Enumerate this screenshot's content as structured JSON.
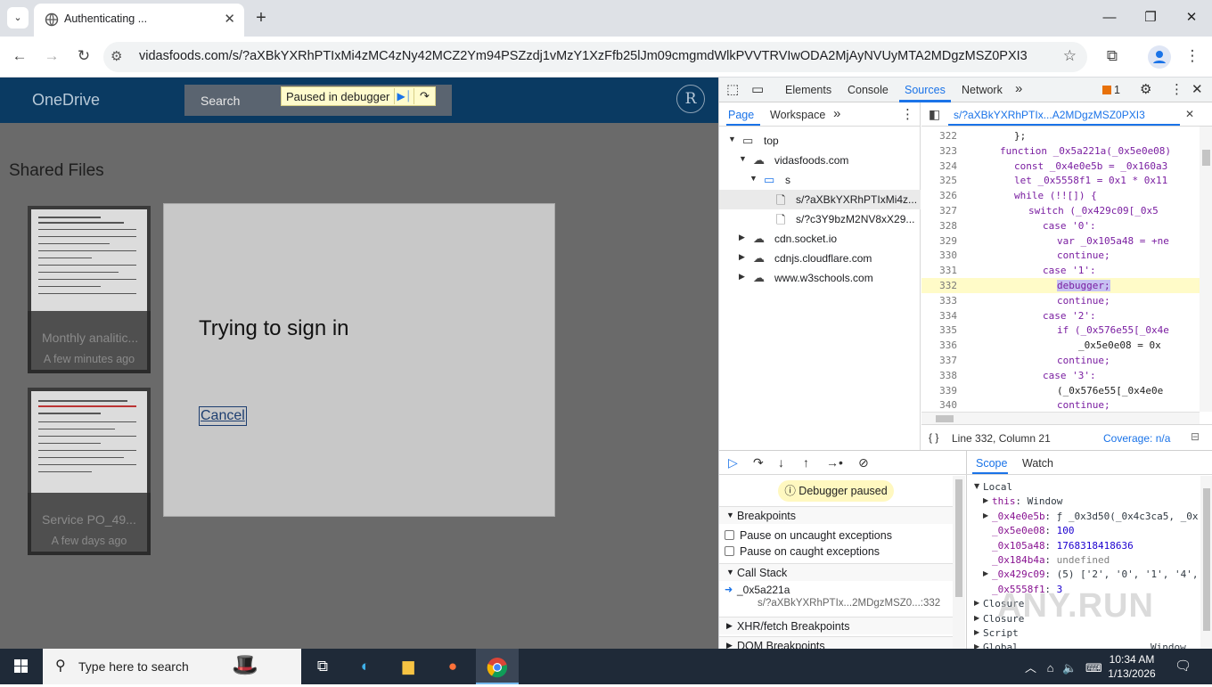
{
  "browser": {
    "tab_title": "Authenticating ...",
    "url": "vidasfoods.com/s/?aXBkYXRhPTIxMi4zMC4zNy42MCZ2Ym94PSZzdj1vMzY1XzFfb25lJm09cmgmdWlkPVVTRVIwODA2MjAyNVUyMTA2MDgzMSZ0PXI3",
    "minimize_glyph": "—",
    "maximize_glyph": "❐",
    "close_glyph": "✕"
  },
  "page": {
    "logo": "OneDrive",
    "search_placeholder": "Search",
    "avatar_letter": "R",
    "paused_label": "Paused in debugger",
    "section_title": "Shared Files",
    "files": [
      {
        "name": "Monthly analitic...",
        "when": "A few minutes ago"
      },
      {
        "name": "Service PO_49...",
        "when": "A few days ago"
      }
    ],
    "dialog_title": "Trying to sign in",
    "dialog_cancel": "Cancel"
  },
  "devtools": {
    "tabs": [
      "Elements",
      "Console",
      "Sources",
      "Network"
    ],
    "active_tab": "Sources",
    "more_tabs": "»",
    "issues_badge": "1",
    "nav_tabs": [
      "Page",
      "Workspace"
    ],
    "tree": [
      {
        "label": "top",
        "icon": "frame-icon"
      },
      {
        "label": "vidasfoods.com",
        "icon": "cloud-icon"
      },
      {
        "label": "s",
        "icon": "folder-icon"
      },
      {
        "label": "s/?aXBkYXRhPTIxMi4z...",
        "icon": "file-icon"
      },
      {
        "label": "s/?c3Y9bzM2NV8xX29...",
        "icon": "file-icon"
      },
      {
        "label": "cdn.socket.io",
        "icon": "cloud-icon"
      },
      {
        "label": "cdnjs.cloudflare.com",
        "icon": "cloud-icon"
      },
      {
        "label": "www.w3schools.com",
        "icon": "cloud-icon"
      }
    ],
    "editor_file": "s/?aXBkYXRhPTIx...A2MDgzMSZ0PXI3",
    "code_lines": [
      {
        "n": "322",
        "text": "};"
      },
      {
        "n": "323",
        "text": "function _0x5a221a(_0x5e0e08)"
      },
      {
        "n": "324",
        "text": "const _0x4e0e5b = _0x160a3"
      },
      {
        "n": "325",
        "text": "let _0x5558f1 = 0x1 * 0x11"
      },
      {
        "n": "326",
        "text": "while (!![]) {"
      },
      {
        "n": "327",
        "text": "switch (_0x429c09[_0x5"
      },
      {
        "n": "328",
        "text": "case '0':"
      },
      {
        "n": "329",
        "text": "var _0x105a48 = +ne"
      },
      {
        "n": "330",
        "text": "continue;"
      },
      {
        "n": "331",
        "text": "case '1':"
      },
      {
        "n": "332",
        "text": "debugger;"
      },
      {
        "n": "333",
        "text": "continue;"
      },
      {
        "n": "334",
        "text": "case '2':"
      },
      {
        "n": "335",
        "text": "if (_0x576e55[_0x4e"
      },
      {
        "n": "336",
        "text": "_0x5e0e08 = 0x"
      },
      {
        "n": "337",
        "text": "continue;"
      },
      {
        "n": "338",
        "text": "case '3':"
      },
      {
        "n": "339",
        "text": "(_0x576e55[_0x4e0e"
      },
      {
        "n": "340",
        "text": "continue;"
      }
    ],
    "status_position": "Line 332, Column 21",
    "status_coverage": "Coverage: n/a",
    "debugger_paused": "Debugger paused",
    "breakpoints_header": "Breakpoints",
    "pause_uncaught": "Pause on uncaught exceptions",
    "pause_caught": "Pause on caught exceptions",
    "call_stack_header": "Call Stack",
    "call_stack_fn": "_0x5a221a",
    "call_stack_loc": "s/?aXBkYXRhPTIx...2MDgzMSZ0...:332",
    "xhr_header": "XHR/fetch Breakpoints",
    "dom_header": "DOM Breakpoints",
    "scope_tabs": [
      "Scope",
      "Watch"
    ],
    "scope": [
      {
        "key": "Local",
        "val": "",
        "level": 0,
        "arrow": "▼"
      },
      {
        "key": "this",
        "val": "Window",
        "level": 1,
        "arrow": "▶"
      },
      {
        "key": "_0x4e0e5b",
        "val": "ƒ _0x3d50(_0x4c3ca5, _0x",
        "level": 1,
        "arrow": "▶"
      },
      {
        "key": "_0x5e0e08",
        "val": "100",
        "level": 1,
        "arrow": ""
      },
      {
        "key": "_0x105a48",
        "val": "1768318418636",
        "level": 1,
        "arrow": ""
      },
      {
        "key": "_0x184b4a",
        "val": "undefined",
        "level": 1,
        "arrow": ""
      },
      {
        "key": "_0x429c09",
        "val": "(5) ['2', '0', '1', '4',",
        "level": 1,
        "arrow": "▶"
      },
      {
        "key": "_0x5558f1",
        "val": "3",
        "level": 1,
        "arrow": ""
      },
      {
        "key": "Closure",
        "val": "",
        "level": 0,
        "arrow": "▶"
      },
      {
        "key": "Closure",
        "val": "",
        "level": 0,
        "arrow": "▶"
      },
      {
        "key": "Script",
        "val": "",
        "level": 0,
        "arrow": "▶"
      },
      {
        "key": "Global",
        "val": "Window",
        "level": 0,
        "arrow": "▶"
      }
    ],
    "watermark": "ANY.RUN"
  },
  "taskbar": {
    "search_placeholder": "Type here to search",
    "time": "10:34 AM",
    "date": "1/13/2026"
  }
}
